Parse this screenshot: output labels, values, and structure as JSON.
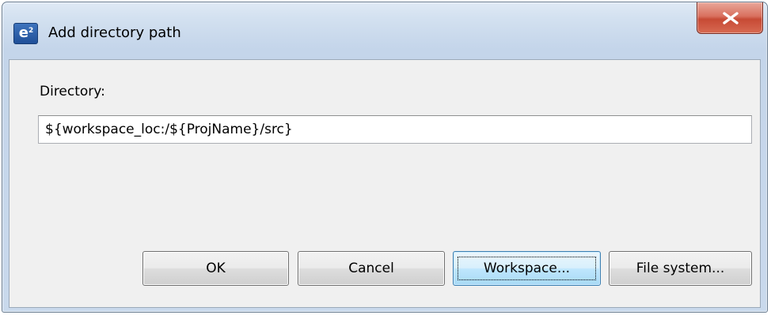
{
  "window": {
    "title": "Add directory path",
    "app_icon_text": "e",
    "app_icon_sup": "2",
    "app_icon": "eclipse-e2-icon",
    "close_icon": "close-x-icon"
  },
  "form": {
    "directory_label": "Directory:",
    "directory_value": "${workspace_loc:/${ProjName}/src}"
  },
  "buttons": {
    "ok": "OK",
    "cancel": "Cancel",
    "workspace": "Workspace...",
    "file_system": "File system..."
  },
  "colors": {
    "close_button": "#c74a35",
    "default_button_border": "#3c7fb1",
    "client_background": "#f0f0f0"
  }
}
